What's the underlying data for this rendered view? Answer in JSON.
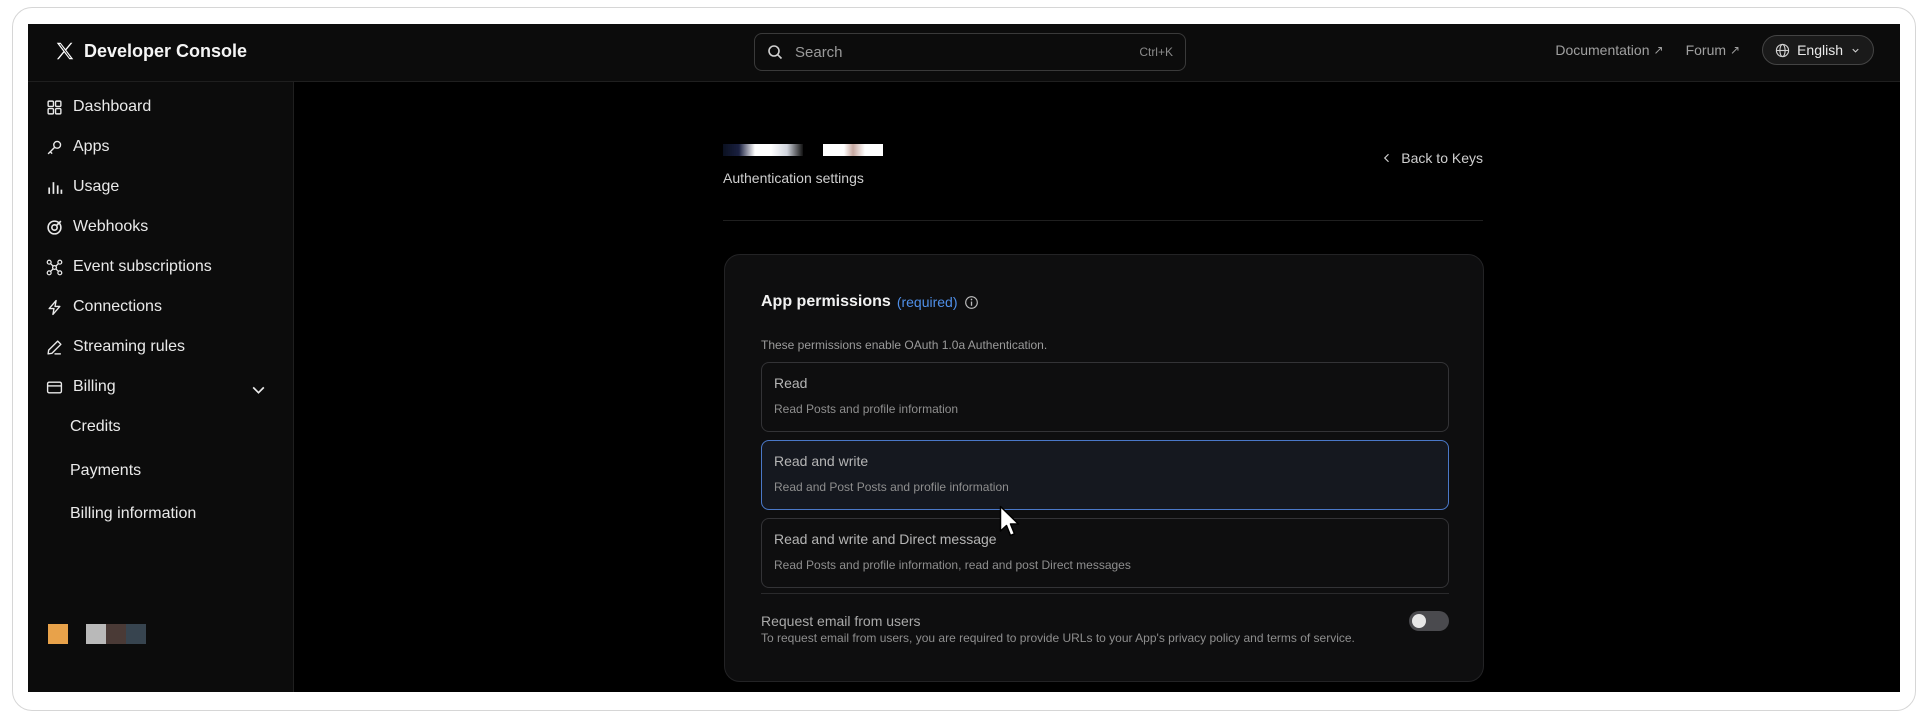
{
  "header": {
    "brand_title": "Developer Console",
    "search_placeholder": "Search",
    "search_shortcut": "Ctrl+K",
    "links": [
      "Documentation",
      "Forum"
    ],
    "language": "English"
  },
  "sidebar": {
    "items": [
      {
        "label": "Dashboard",
        "icon": "grid-icon"
      },
      {
        "label": "Apps",
        "icon": "key-icon"
      },
      {
        "label": "Usage",
        "icon": "bar-chart-icon"
      },
      {
        "label": "Webhooks",
        "icon": "webhook-icon"
      },
      {
        "label": "Event subscriptions",
        "icon": "nodes-icon"
      },
      {
        "label": "Connections",
        "icon": "lightning-icon"
      },
      {
        "label": "Streaming rules",
        "icon": "pencil-icon"
      },
      {
        "label": "Billing",
        "icon": "credit-card-icon"
      }
    ],
    "billing_sub": [
      "Credits",
      "Payments",
      "Billing information"
    ]
  },
  "page": {
    "subtitle": "Authentication settings",
    "back_label": "Back to Keys"
  },
  "permissions": {
    "title": "App permissions",
    "required": "(required)",
    "description": "These permissions enable OAuth 1.0a Authentication.",
    "options": [
      {
        "title": "Read",
        "desc": "Read Posts and profile information",
        "selected": false
      },
      {
        "title": "Read and write",
        "desc": "Read and Post Posts and profile information",
        "selected": true
      },
      {
        "title": "Read and write and Direct message",
        "desc": "Read Posts and profile information, read and post Direct messages",
        "selected": false
      }
    ],
    "email_title": "Request email from users",
    "email_desc": "To request email from users, you are required to provide URLs to your App's privacy policy and terms of service.",
    "email_enabled": false
  },
  "colors": {
    "accent": "#4f8fe8",
    "selected_border": "#4a78c8"
  }
}
